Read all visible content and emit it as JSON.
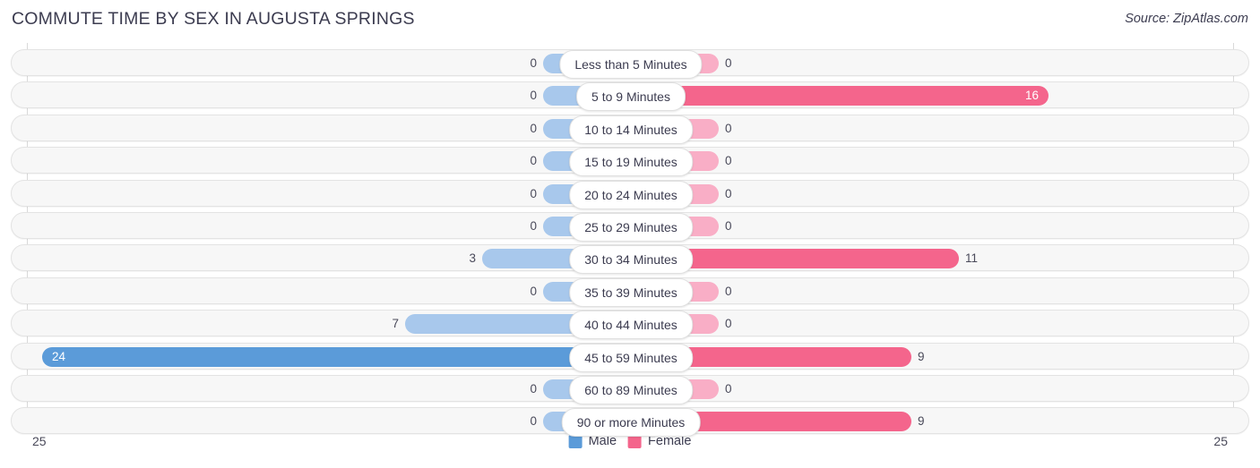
{
  "header": {
    "title": "COMMUTE TIME BY SEX IN AUGUSTA SPRINGS",
    "source": "Source: ZipAtlas.com"
  },
  "axis": {
    "left_tick": "25",
    "right_tick": "25"
  },
  "legend": {
    "items": [
      {
        "label": "Male",
        "color": "#5b9bd9"
      },
      {
        "label": "Female",
        "color": "#f4658c"
      }
    ]
  },
  "colors": {
    "male_light": "#a8c8ec",
    "male_strong": "#5b9bd9",
    "female_light": "#f9aec6",
    "female_strong": "#f4658c",
    "row_bg": "#f7f7f7",
    "row_border": "#e3e3e3",
    "text": "#3c3c50"
  },
  "chart_data": {
    "type": "bar",
    "title": "COMMUTE TIME BY SEX IN AUGUSTA SPRINGS",
    "orientation": "horizontal-diverging",
    "xlabel": "",
    "ylabel": "",
    "xlim": [
      25,
      25
    ],
    "axis_max": 25,
    "grid": false,
    "legend_position": "bottom-center",
    "categories": [
      "Less than 5 Minutes",
      "5 to 9 Minutes",
      "10 to 14 Minutes",
      "15 to 19 Minutes",
      "20 to 24 Minutes",
      "25 to 29 Minutes",
      "30 to 34 Minutes",
      "35 to 39 Minutes",
      "40 to 44 Minutes",
      "45 to 59 Minutes",
      "60 to 89 Minutes",
      "90 or more Minutes"
    ],
    "series": [
      {
        "name": "Male",
        "values": [
          0,
          0,
          0,
          0,
          0,
          0,
          3,
          0,
          7,
          24,
          0,
          0
        ]
      },
      {
        "name": "Female",
        "values": [
          0,
          16,
          0,
          0,
          0,
          0,
          11,
          0,
          0,
          9,
          0,
          9
        ]
      }
    ]
  },
  "rows": [
    {
      "category": "Less than 5 Minutes",
      "male": "0",
      "female": "0",
      "male_w": 62,
      "female_w": 62,
      "male_strong": false,
      "female_strong": false,
      "male_inside": false,
      "female_inside": false
    },
    {
      "category": "5 to 9 Minutes",
      "male": "0",
      "female": "16",
      "male_w": 62,
      "female_w": 430,
      "male_strong": false,
      "female_strong": true,
      "male_inside": false,
      "female_inside": true
    },
    {
      "category": "10 to 14 Minutes",
      "male": "0",
      "female": "0",
      "male_w": 62,
      "female_w": 62,
      "male_strong": false,
      "female_strong": false,
      "male_inside": false,
      "female_inside": false
    },
    {
      "category": "15 to 19 Minutes",
      "male": "0",
      "female": "0",
      "male_w": 62,
      "female_w": 62,
      "male_strong": false,
      "female_strong": false,
      "male_inside": false,
      "female_inside": false
    },
    {
      "category": "20 to 24 Minutes",
      "male": "0",
      "female": "0",
      "male_w": 62,
      "female_w": 62,
      "male_strong": false,
      "female_strong": false,
      "male_inside": false,
      "female_inside": false
    },
    {
      "category": "25 to 29 Minutes",
      "male": "0",
      "female": "0",
      "male_w": 62,
      "female_w": 62,
      "male_strong": false,
      "female_strong": false,
      "male_inside": false,
      "female_inside": false
    },
    {
      "category": "30 to 34 Minutes",
      "male": "3",
      "female": "11",
      "male_w": 130,
      "female_w": 330,
      "male_strong": false,
      "female_strong": true,
      "male_inside": false,
      "female_inside": false
    },
    {
      "category": "35 to 39 Minutes",
      "male": "0",
      "female": "0",
      "male_w": 62,
      "female_w": 62,
      "male_strong": false,
      "female_strong": false,
      "male_inside": false,
      "female_inside": false
    },
    {
      "category": "40 to 44 Minutes",
      "male": "7",
      "female": "0",
      "male_w": 216,
      "female_w": 62,
      "male_strong": false,
      "female_strong": false,
      "male_inside": false,
      "female_inside": false
    },
    {
      "category": "45 to 59 Minutes",
      "male": "24",
      "female": "9",
      "male_w": 621,
      "female_w": 277,
      "male_strong": true,
      "female_strong": true,
      "male_inside": true,
      "female_inside": false
    },
    {
      "category": "60 to 89 Minutes",
      "male": "0",
      "female": "0",
      "male_w": 62,
      "female_w": 62,
      "male_strong": false,
      "female_strong": false,
      "male_inside": false,
      "female_inside": false
    },
    {
      "category": "90 or more Minutes",
      "male": "0",
      "female": "9",
      "male_w": 62,
      "female_w": 277,
      "male_strong": false,
      "female_strong": true,
      "male_inside": false,
      "female_inside": false
    }
  ]
}
